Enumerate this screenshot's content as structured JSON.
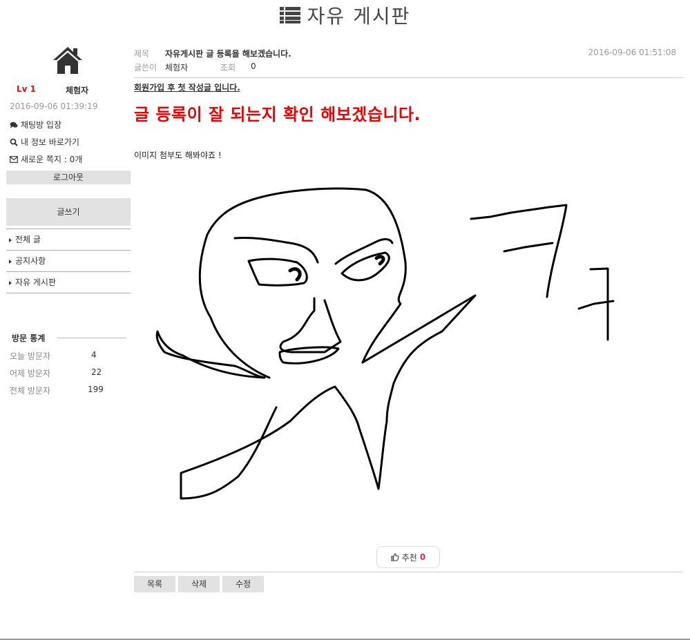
{
  "header": {
    "title": "자유 게시판",
    "icon": "list-icon"
  },
  "sidebar": {
    "home_icon": "home-icon",
    "level": "Lv 1",
    "nickname": "체험자",
    "login_time": "2016-09-06 01:39:19",
    "links": [
      {
        "icon": "chat-icon",
        "label": "채팅방 입장"
      },
      {
        "icon": "search-icon",
        "label": "내 정보 바로가기"
      },
      {
        "icon": "envelope-icon",
        "label": "새로운 쪽지 : 0개"
      }
    ],
    "logout_label": "로그아웃",
    "write_label": "글쓰기",
    "menu": [
      {
        "label": "전체 글"
      },
      {
        "label": "공지사항"
      },
      {
        "label": "자유 게시판"
      }
    ],
    "stats": {
      "title": "방문 통계",
      "rows": [
        {
          "label": "오늘 방문자",
          "value": "4"
        },
        {
          "label": "어제 방문자",
          "value": "22"
        },
        {
          "label": "전체 방문자",
          "value": "199"
        }
      ]
    }
  },
  "post": {
    "title_label": "제목",
    "title": "자유게시판 글 등록을 해보겠습니다.",
    "author_label": "글쓴이",
    "author": "체험자",
    "views_label": "조회",
    "views": "0",
    "date": "2016-09-06 01:51:08",
    "subheading": "회원가입 후 첫 작성글 입니다.",
    "headline": "글 등록이 잘 되는지 확인 해보겠습니다.",
    "body": "이미지 첨부도 해봐야죠 !",
    "recommend_label": "추천",
    "recommend_count": "0",
    "recommend_icon": "thumbs-up-icon"
  },
  "actions": {
    "list": "목록",
    "delete": "삭제",
    "edit": "수정"
  }
}
